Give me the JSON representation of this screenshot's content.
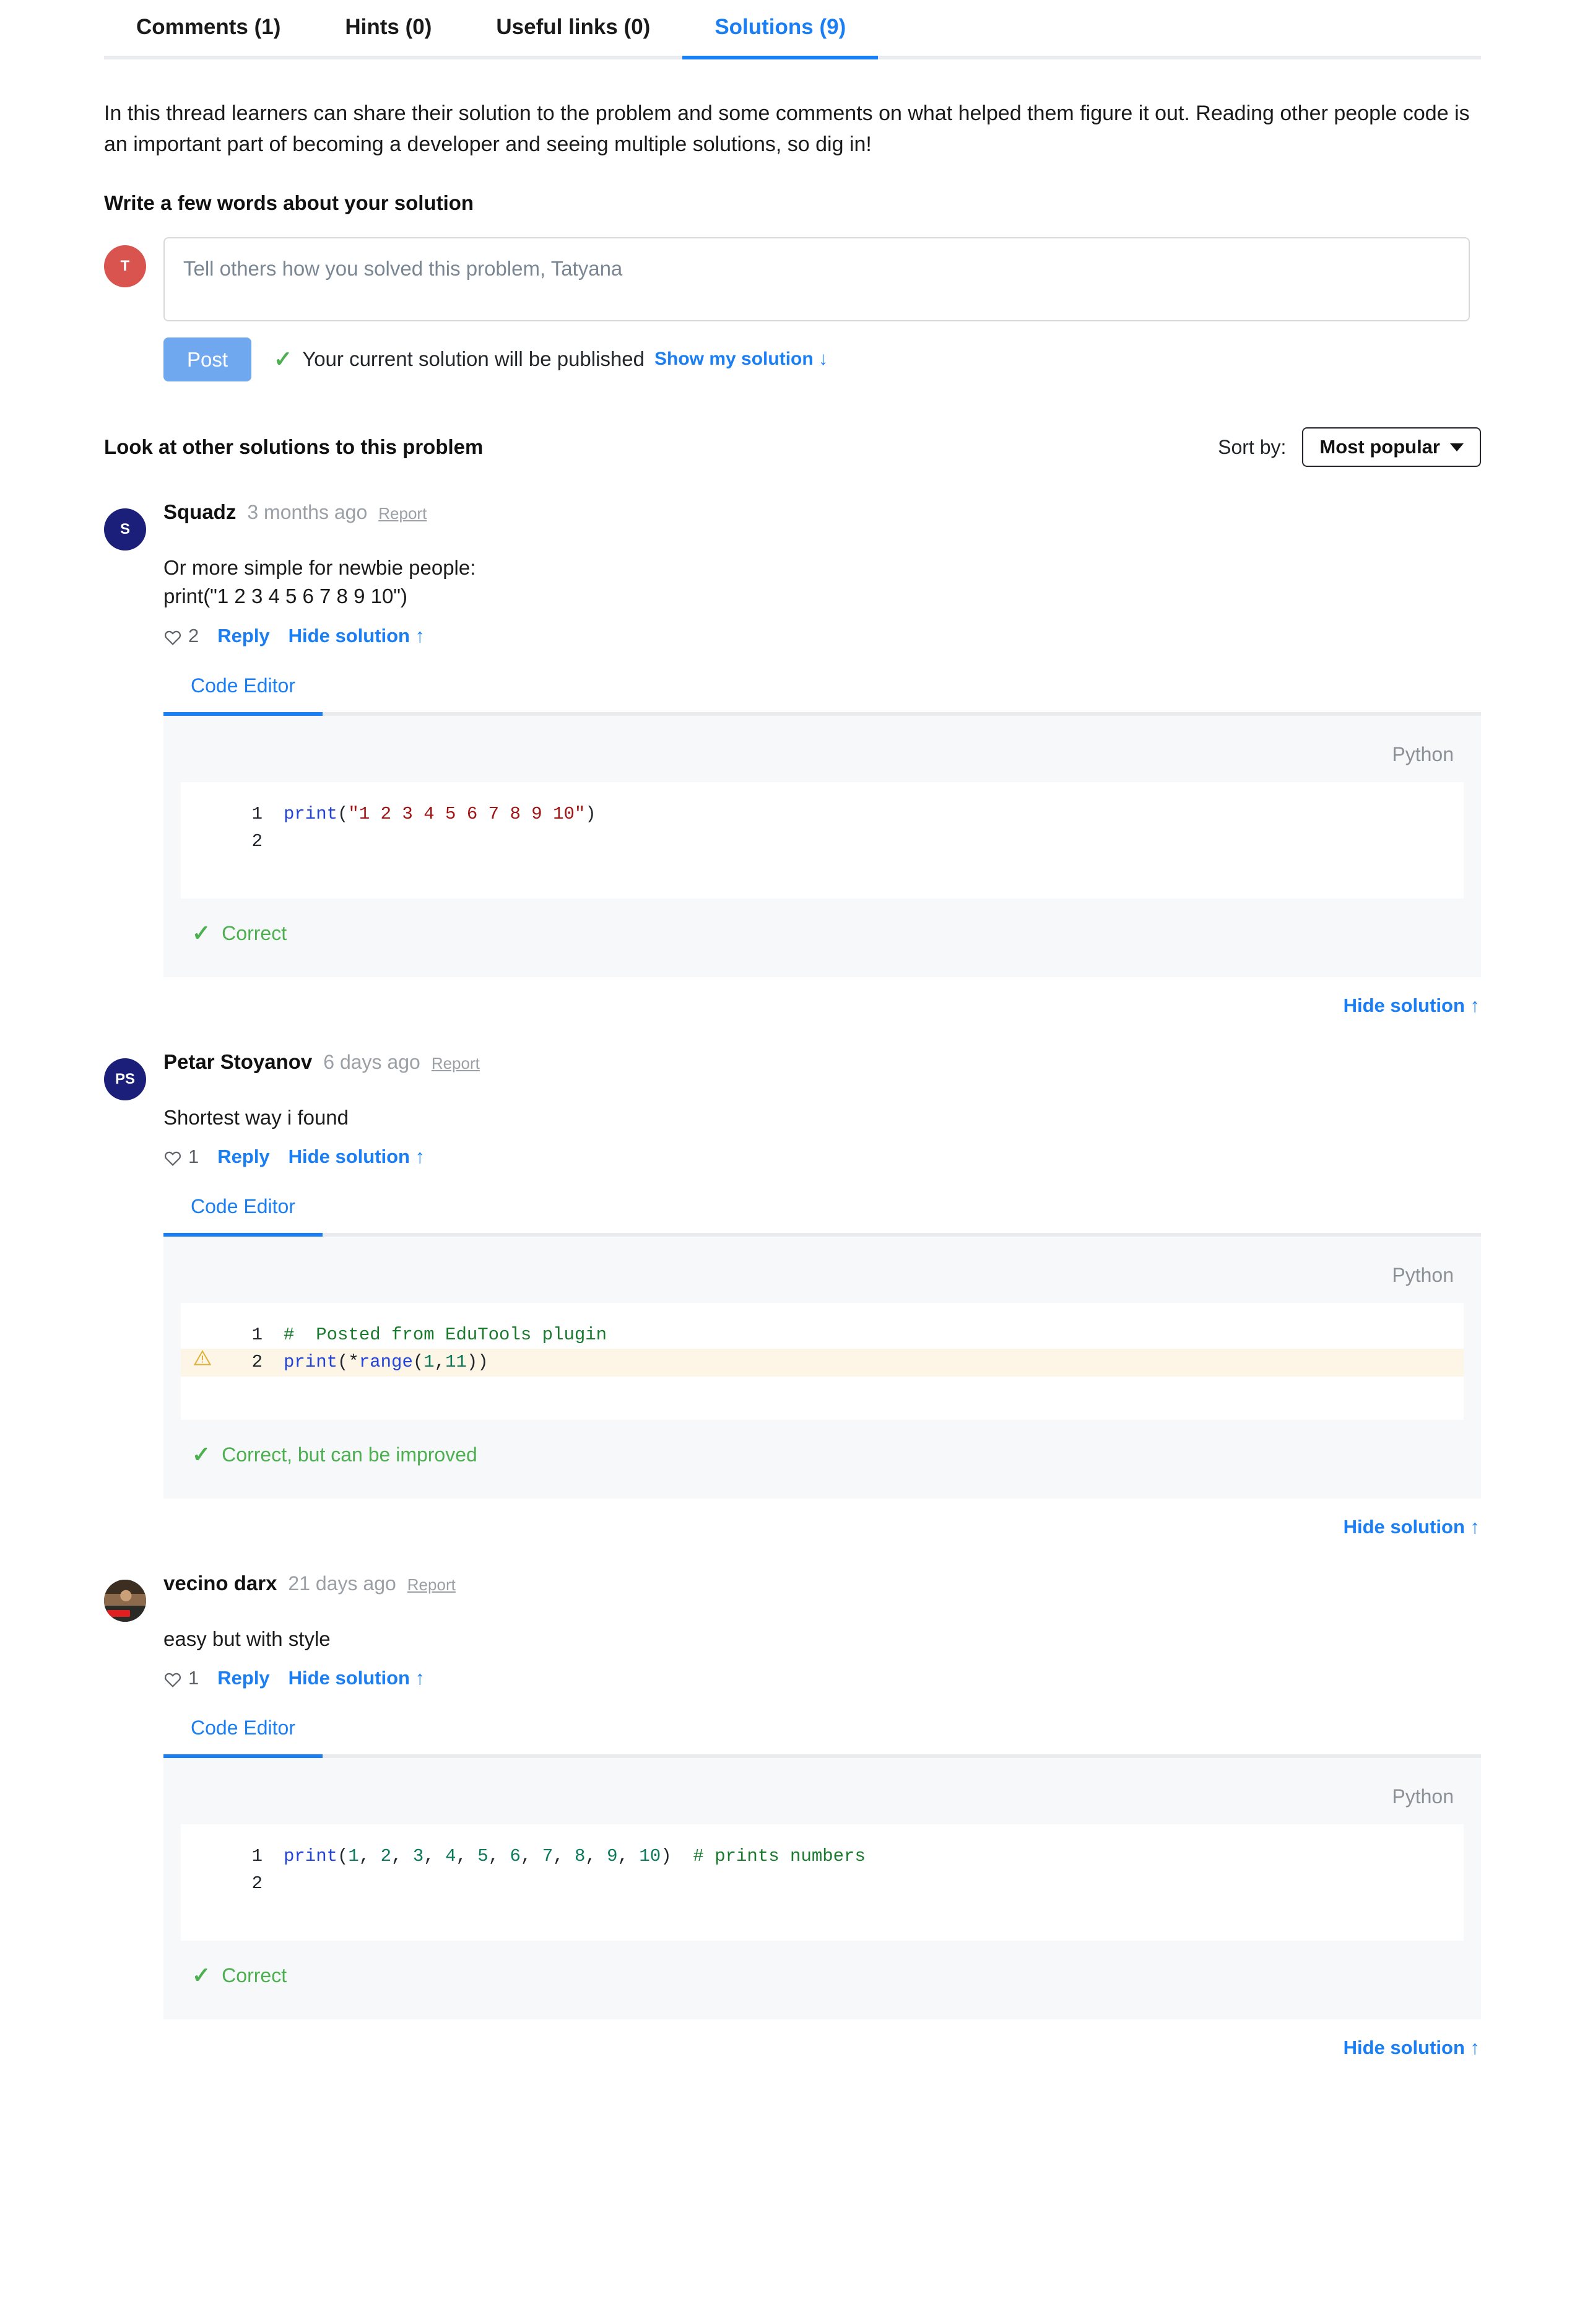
{
  "tabs": [
    {
      "label": "Comments (1)",
      "active": false,
      "name": "tab-comments"
    },
    {
      "label": "Hints (0)",
      "active": false,
      "name": "tab-hints"
    },
    {
      "label": "Useful links (0)",
      "active": false,
      "name": "tab-useful-links"
    },
    {
      "label": "Solutions (9)",
      "active": true,
      "name": "tab-solutions"
    }
  ],
  "intro": "In this thread learners can share their solution to the problem and some comments on what helped them figure it out. Reading other people code is an important part of becoming a developer and seeing multiple solutions, so dig in!",
  "compose": {
    "heading": "Write a few words about your solution",
    "avatar_initial": "T",
    "avatar_color": "#d9534f",
    "placeholder": "Tell others how you solved this problem, Tatyana",
    "value": "",
    "post_label": "Post",
    "publish_note": "Your current solution will be published",
    "show_my_solution": "Show my solution ↓"
  },
  "others": {
    "title": "Look at other solutions to this problem",
    "sort_label": "Sort by:",
    "sort_value": "Most popular"
  },
  "common": {
    "report": "Report",
    "reply": "Reply",
    "hide_solution": "Hide solution ↑",
    "code_editor_tab": "Code Editor",
    "language": "Python"
  },
  "accent": "#1a7ef5",
  "solutions": [
    {
      "author": "Squadz",
      "avatar_initial": "S",
      "avatar_kind": "navy",
      "time": "3 months ago",
      "report": "Report",
      "text": "Or more simple for newbie people:\nprint(\"1 2 3 4 5 6 7 8 9 10\")",
      "likes": "2",
      "reply": "Reply",
      "hide_inline": "Hide solution ↑",
      "editor_tab": "Code Editor",
      "language": "Python",
      "code": [
        {
          "no": "1",
          "warn": false,
          "tokens": [
            {
              "t": "print",
              "c": "tok-fn"
            },
            {
              "t": "(",
              "c": "tok-plain"
            },
            {
              "t": "\"1 2 3 4 5 6 7 8 9 10\"",
              "c": "tok-str"
            },
            {
              "t": ")",
              "c": "tok-plain"
            }
          ]
        },
        {
          "no": "2",
          "warn": false,
          "tokens": []
        }
      ],
      "status": "Correct",
      "hide_bottom": "Hide solution ↑"
    },
    {
      "author": "Petar Stoyanov",
      "avatar_initial": "PS",
      "avatar_kind": "navy",
      "time": "6 days ago",
      "report": "Report",
      "text": "Shortest way i found",
      "likes": "1",
      "reply": "Reply",
      "hide_inline": "Hide solution ↑",
      "editor_tab": "Code Editor",
      "language": "Python",
      "code": [
        {
          "no": "1",
          "warn": false,
          "tokens": [
            {
              "t": "#  Posted from EduTools plugin",
              "c": "tok-com"
            }
          ]
        },
        {
          "no": "2",
          "warn": true,
          "tokens": [
            {
              "t": "print",
              "c": "tok-fn"
            },
            {
              "t": "(",
              "c": "tok-plain"
            },
            {
              "t": "*",
              "c": "tok-plain"
            },
            {
              "t": "range",
              "c": "tok-fn"
            },
            {
              "t": "(",
              "c": "tok-plain"
            },
            {
              "t": "1",
              "c": "tok-num"
            },
            {
              "t": ",",
              "c": "tok-plain"
            },
            {
              "t": "11",
              "c": "tok-num"
            },
            {
              "t": "))",
              "c": "tok-plain"
            }
          ]
        }
      ],
      "status": "Correct, but can be improved",
      "hide_bottom": "Hide solution ↑"
    },
    {
      "author": "vecino darx",
      "avatar_initial": "",
      "avatar_kind": "photo",
      "time": "21 days ago",
      "report": "Report",
      "text": "easy but with style",
      "likes": "1",
      "reply": "Reply",
      "hide_inline": "Hide solution ↑",
      "editor_tab": "Code Editor",
      "language": "Python",
      "code": [
        {
          "no": "1",
          "warn": false,
          "tokens": [
            {
              "t": "print",
              "c": "tok-fn"
            },
            {
              "t": "(",
              "c": "tok-plain"
            },
            {
              "t": "1",
              "c": "tok-num"
            },
            {
              "t": ", ",
              "c": "tok-plain"
            },
            {
              "t": "2",
              "c": "tok-num"
            },
            {
              "t": ", ",
              "c": "tok-plain"
            },
            {
              "t": "3",
              "c": "tok-num"
            },
            {
              "t": ", ",
              "c": "tok-plain"
            },
            {
              "t": "4",
              "c": "tok-num"
            },
            {
              "t": ", ",
              "c": "tok-plain"
            },
            {
              "t": "5",
              "c": "tok-num"
            },
            {
              "t": ", ",
              "c": "tok-plain"
            },
            {
              "t": "6",
              "c": "tok-num"
            },
            {
              "t": ", ",
              "c": "tok-plain"
            },
            {
              "t": "7",
              "c": "tok-num"
            },
            {
              "t": ", ",
              "c": "tok-plain"
            },
            {
              "t": "8",
              "c": "tok-num"
            },
            {
              "t": ", ",
              "c": "tok-plain"
            },
            {
              "t": "9",
              "c": "tok-num"
            },
            {
              "t": ", ",
              "c": "tok-plain"
            },
            {
              "t": "10",
              "c": "tok-num"
            },
            {
              "t": ")  ",
              "c": "tok-plain"
            },
            {
              "t": "# prints numbers",
              "c": "tok-com"
            }
          ]
        },
        {
          "no": "2",
          "warn": false,
          "tokens": []
        }
      ],
      "status": "Correct",
      "hide_bottom": "Hide solution ↑"
    }
  ]
}
